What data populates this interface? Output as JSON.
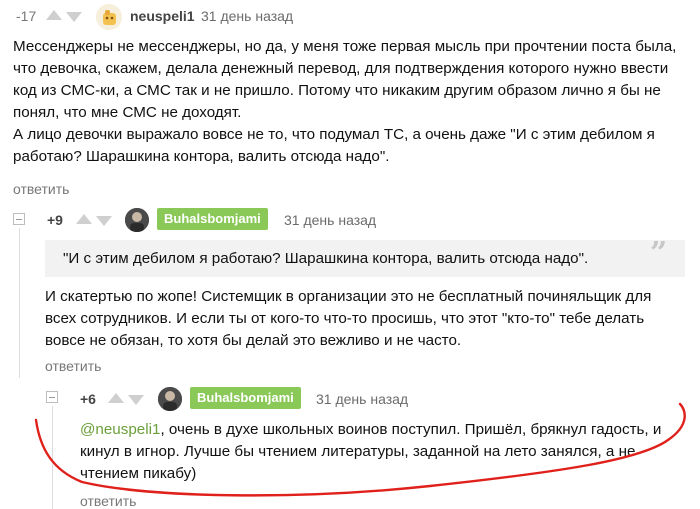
{
  "comments": [
    {
      "rating": "-17",
      "username": "neuspeli1",
      "time": "31 день назад",
      "paragraphs": [
        "Мессенджеры не мессенджеры, но да, у меня тоже первая мысль при прочтении поста была,",
        "что девочка, скажем, делала денежный перевод, для подтверждения которого нужно ввести",
        "код из СМС-ки, а СМС так и не пришло. Потому что никаким другим образом лично я бы не",
        "понял, что мне СМС не доходят.",
        "А лицо девочки выражало вовсе не то, что подумал ТС, а очень даже \"И с этим дебилом я",
        "работаю? Шарашкина контора, валить отсюда надо\"."
      ],
      "reply_label": "ответить"
    },
    {
      "rating": "+9",
      "username": "Buhalsbomjami",
      "time": "31 день назад",
      "quote": "\"И с этим дебилом я работаю? Шарашкина контора, валить отсюда надо\".",
      "paragraphs": [
        "И скатертью по жопе! Системщик в организации это не бесплатный починяльщик для",
        "всех сотрудников. И если ты от кого-то что-то просишь, что этот \"кто-то\" тебе делать",
        "вовсе не обязан, то хотя бы делай это вежливо и не часто."
      ],
      "reply_label": "ответить"
    },
    {
      "rating": "+6",
      "username": "Buhalsbomjami",
      "time": "31 день назад",
      "mention": "@neuspeli1",
      "line1_rest": ", очень в духе школьных воинов поступил. Пришёл, брякнул гадость, и",
      "paragraphs": [
        "кинул в игнор. Лучше бы чтением литературы, заданной на лето занялся, а не",
        "чтением пикабу)"
      ],
      "reply_label": "ответить"
    }
  ],
  "colors": {
    "accent_green": "#8ac858",
    "mention_green": "#6a9f3a",
    "annotation_red": "#e0201a"
  },
  "icons": [
    "arrow-up-icon",
    "arrow-down-icon",
    "avatar",
    "collapse-icon",
    "quote-icon"
  ]
}
